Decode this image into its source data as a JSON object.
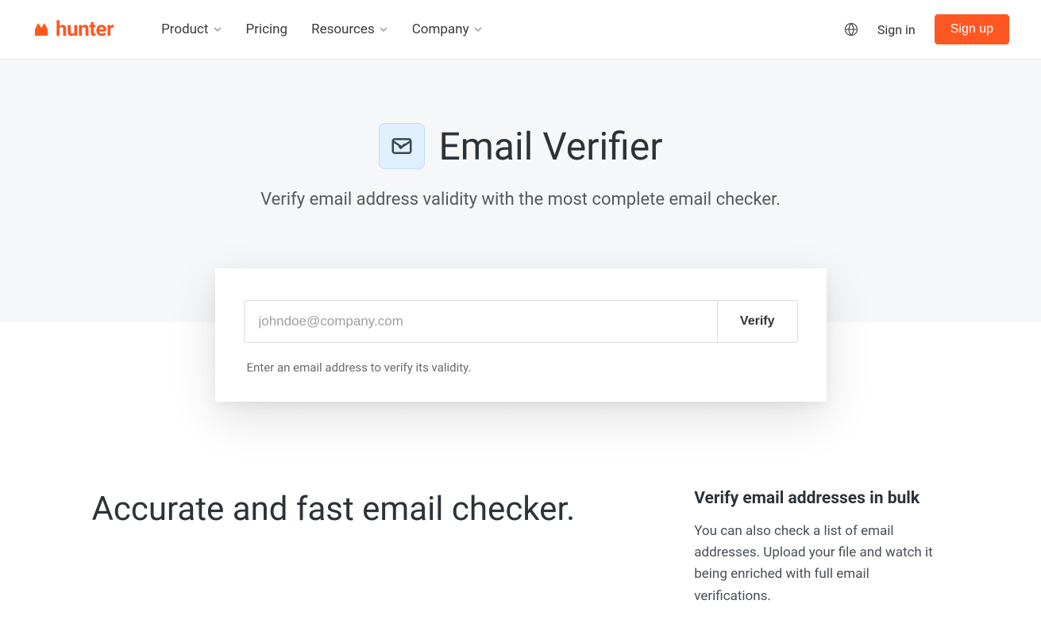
{
  "header": {
    "logo_text": "hunter",
    "nav": {
      "product": "Product",
      "pricing": "Pricing",
      "resources": "Resources",
      "company": "Company"
    },
    "signin": "Sign in",
    "signup": "Sign up"
  },
  "hero": {
    "title": "Email Verifier",
    "subtitle": "Verify email address validity with the most complete email checker."
  },
  "search": {
    "placeholder": "johndoe@company.com",
    "button": "Verify",
    "hint": "Enter an email address to verify its validity."
  },
  "content": {
    "left_heading": "Accurate and fast email checker.",
    "right_heading": "Verify email addresses in bulk",
    "right_body": "You can also check a list of email addresses. Upload your file and watch it being enriched with full email verifications."
  }
}
